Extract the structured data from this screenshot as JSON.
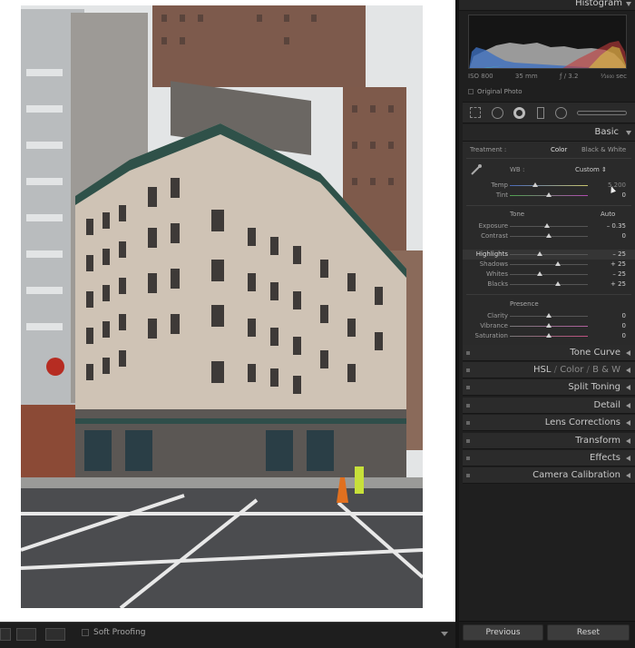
{
  "toolbar": {
    "soft_proofing_label": "Soft Proofing"
  },
  "histogram": {
    "title": "Histogram",
    "iso": "ISO 800",
    "focal": "35 mm",
    "aperture": "ƒ / 3.2",
    "shutter": "¹⁄₁₆₀₀ sec",
    "original_photo_label": "Original Photo"
  },
  "basic": {
    "title": "Basic",
    "treatment_label": "Treatment :",
    "color_label": "Color",
    "bw_label": "Black & White",
    "wb_label": "WB :",
    "wb_value": "Custom ⇕",
    "temp": {
      "label": "Temp",
      "value": "5,200"
    },
    "tint": {
      "label": "Tint",
      "value": "0"
    },
    "tone_label": "Tone",
    "auto_label": "Auto",
    "exposure": {
      "label": "Exposure",
      "value": "– 0.35"
    },
    "contrast": {
      "label": "Contrast",
      "value": "0"
    },
    "highlights": {
      "label": "Highlights",
      "value": "– 25"
    },
    "shadows": {
      "label": "Shadows",
      "value": "+ 25"
    },
    "whites": {
      "label": "Whites",
      "value": "– 25"
    },
    "blacks": {
      "label": "Blacks",
      "value": "+ 25"
    },
    "presence_label": "Presence",
    "clarity": {
      "label": "Clarity",
      "value": "0"
    },
    "vibrance": {
      "label": "Vibrance",
      "value": "0"
    },
    "saturation": {
      "label": "Saturation",
      "value": "0"
    }
  },
  "panels": {
    "tone_curve": "Tone Curve",
    "hsl": "HSL",
    "hsl_color": "Color",
    "hsl_bw": "B & W",
    "split_toning": "Split Toning",
    "detail": "Detail",
    "lens_corrections": "Lens Corrections",
    "transform": "Transform",
    "effects": "Effects",
    "camera_calibration": "Camera Calibration"
  },
  "footer": {
    "previous_label": "Previous",
    "reset_label": "Reset"
  },
  "colors": {
    "panel_bg": "#1f1f1f",
    "section_bg": "#2a2a2a",
    "canvas_bg": "#ffffff"
  }
}
